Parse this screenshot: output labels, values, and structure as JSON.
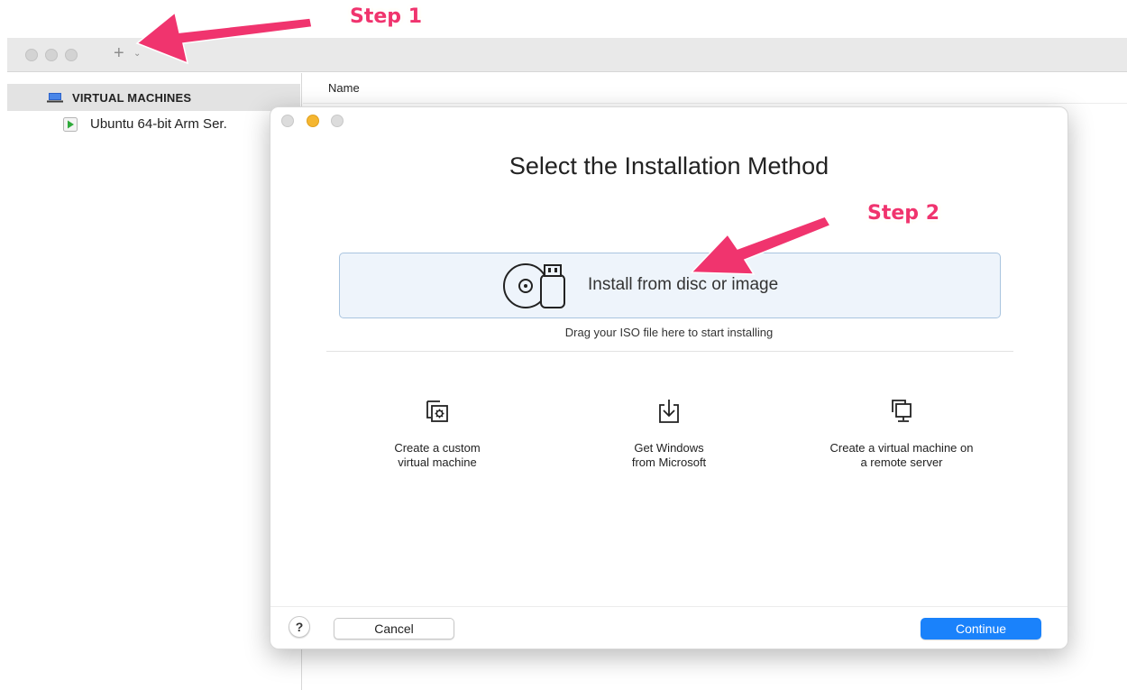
{
  "sidebar": {
    "section_label": "VIRTUAL MACHINES",
    "items": [
      {
        "label": "Ubuntu 64-bit Arm Ser."
      }
    ]
  },
  "list": {
    "column_name": "Name"
  },
  "dialog": {
    "title": "Select the Installation Method",
    "install_label": "Install from disc or image",
    "drag_hint": "Drag your ISO file here to start installing",
    "options": [
      {
        "line1": "Create a custom",
        "line2": "virtual machine",
        "icon": "custom-vm-icon"
      },
      {
        "line1": "Get Windows",
        "line2": "from Microsoft",
        "icon": "download-icon"
      },
      {
        "line1": "Create a virtual machine on",
        "line2": "a remote server",
        "icon": "remote-server-icon"
      }
    ],
    "help_label": "?",
    "cancel_label": "Cancel",
    "continue_label": "Continue"
  },
  "annotations": {
    "step1": "Step 1",
    "step2": "Step 2"
  },
  "colors": {
    "accent": "#1a82fb",
    "annotation": "#f0346e",
    "minimize_dot": "#f5b630"
  }
}
